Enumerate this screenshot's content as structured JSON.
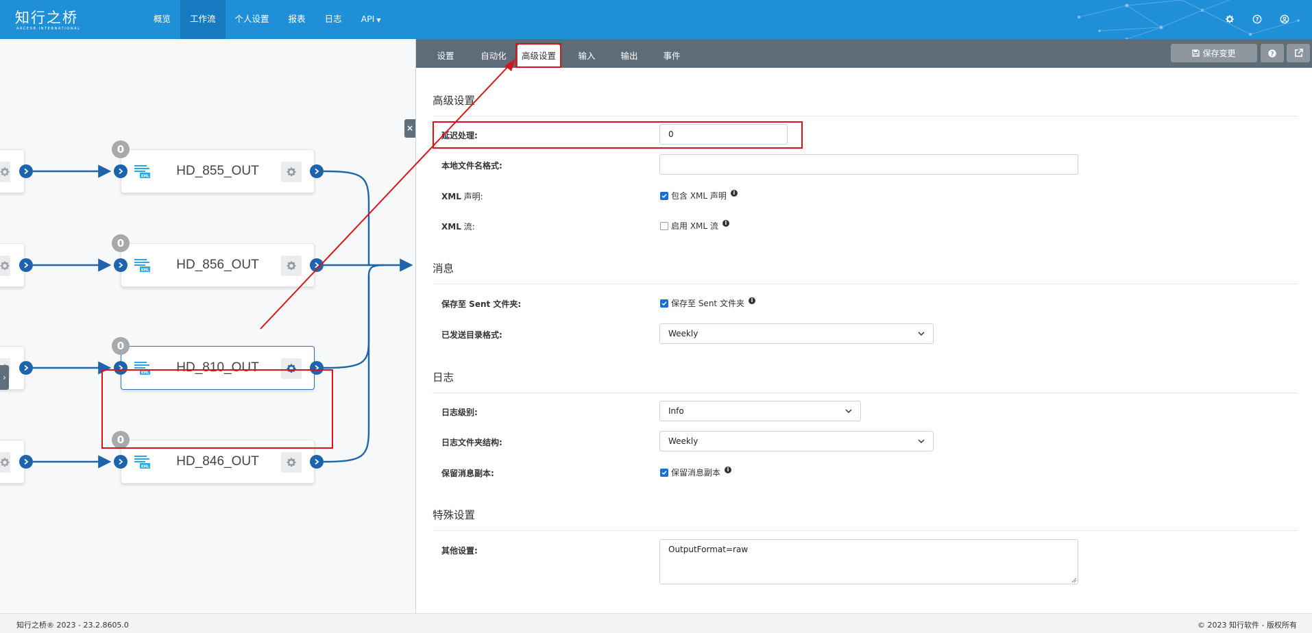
{
  "header": {
    "brand": "知行之桥",
    "brand_sub": "ARCESB INTERNATIONAL",
    "nav": [
      {
        "label": "概览"
      },
      {
        "label": "工作流",
        "active": true
      },
      {
        "label": "个人设置"
      },
      {
        "label": "报表"
      },
      {
        "label": "日志"
      },
      {
        "label": "API",
        "dropdown": true
      }
    ],
    "icons": [
      "gear-icon",
      "help-icon",
      "user-icon"
    ]
  },
  "flow": {
    "nodes": [
      {
        "name": "HD_855_OUT",
        "count": "0",
        "selected": false
      },
      {
        "name": "HD_856_OUT",
        "count": "0",
        "selected": false
      },
      {
        "name": "HD_810_OUT",
        "count": "0",
        "selected": true
      },
      {
        "name": "HD_846_OUT",
        "count": "0",
        "selected": false
      }
    ],
    "close_label": "×",
    "toggle_label": "›"
  },
  "panel": {
    "tabs": [
      {
        "label": "设置"
      },
      {
        "label": "自动化"
      },
      {
        "label": "高级设置",
        "active": true
      },
      {
        "label": "输入"
      },
      {
        "label": "输出"
      },
      {
        "label": "事件"
      }
    ],
    "save_label": "保存变更",
    "sections": {
      "advanced": "高级设置",
      "messages": "消息",
      "logging": "日志",
      "special": "特殊设置"
    },
    "fields": {
      "delay_label": "延迟处理:",
      "delay_value": "0",
      "filename_label": "本地文件名格式:",
      "filename_value": "",
      "xml_decl_label_a": "XML",
      "xml_decl_label_b": " 声明:",
      "xml_decl_check": "包含 XML 声明",
      "xml_stream_label_a": "XML",
      "xml_stream_label_b": " 流:",
      "xml_stream_check": "启用 XML 流",
      "save_sent_label": "保存至 Sent 文件夹:",
      "save_sent_check": "保存至 Sent 文件夹",
      "sent_dir_label": "已发送目录格式:",
      "sent_dir_value": "Weekly",
      "log_level_label": "日志级别:",
      "log_level_value": "Info",
      "log_folder_label": "日志文件夹结构:",
      "log_folder_value": "Weekly",
      "keep_copy_label": "保留消息副本:",
      "keep_copy_check": "保留消息副本",
      "other_label": "其他设置:",
      "other_value": "OutputFormat=raw"
    },
    "checks": {
      "xml_decl": true,
      "xml_stream": false,
      "save_sent": true,
      "keep_copy": true
    }
  },
  "footer": {
    "left": "知行之桥® 2023 - 23.2.8605.0",
    "right": "© 2023 知行软件 - 版权所有"
  },
  "colors": {
    "header": "#1f8fd8",
    "tabbar": "#5e6c78",
    "port": "#1e64ac",
    "highlight": "#d8141a"
  }
}
